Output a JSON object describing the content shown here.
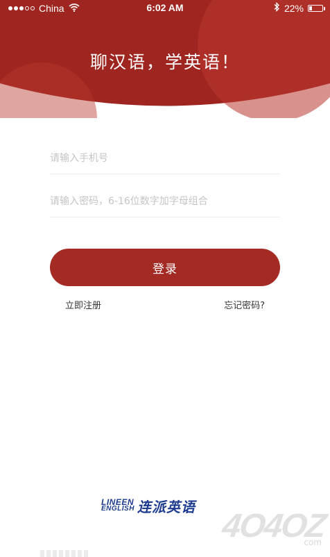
{
  "status_bar": {
    "carrier": "China",
    "time": "6:02 AM",
    "battery_text": "22%",
    "battery_level": 0.22,
    "signal_bars_filled": 3,
    "signal_bars_total": 5
  },
  "header": {
    "slogan": "聊汉语，学英语！",
    "color_primary": "#9f2620",
    "color_secondary": "#b8372f"
  },
  "login_form": {
    "phone_placeholder": "请输入手机号",
    "password_placeholder": "请输入密码，6-16位数字加字母组合",
    "login_label": "登录",
    "register_label": "立即注册",
    "forgot_label": "忘记密码?",
    "button_color": "#a42a24"
  },
  "brand": {
    "en_line1": "LINEEN",
    "en_line2": "ENGLISH",
    "cn_name": "连派英语",
    "color": "#1d3b8f"
  },
  "watermark": {
    "text": "4O4OZ",
    "sub": "com"
  }
}
